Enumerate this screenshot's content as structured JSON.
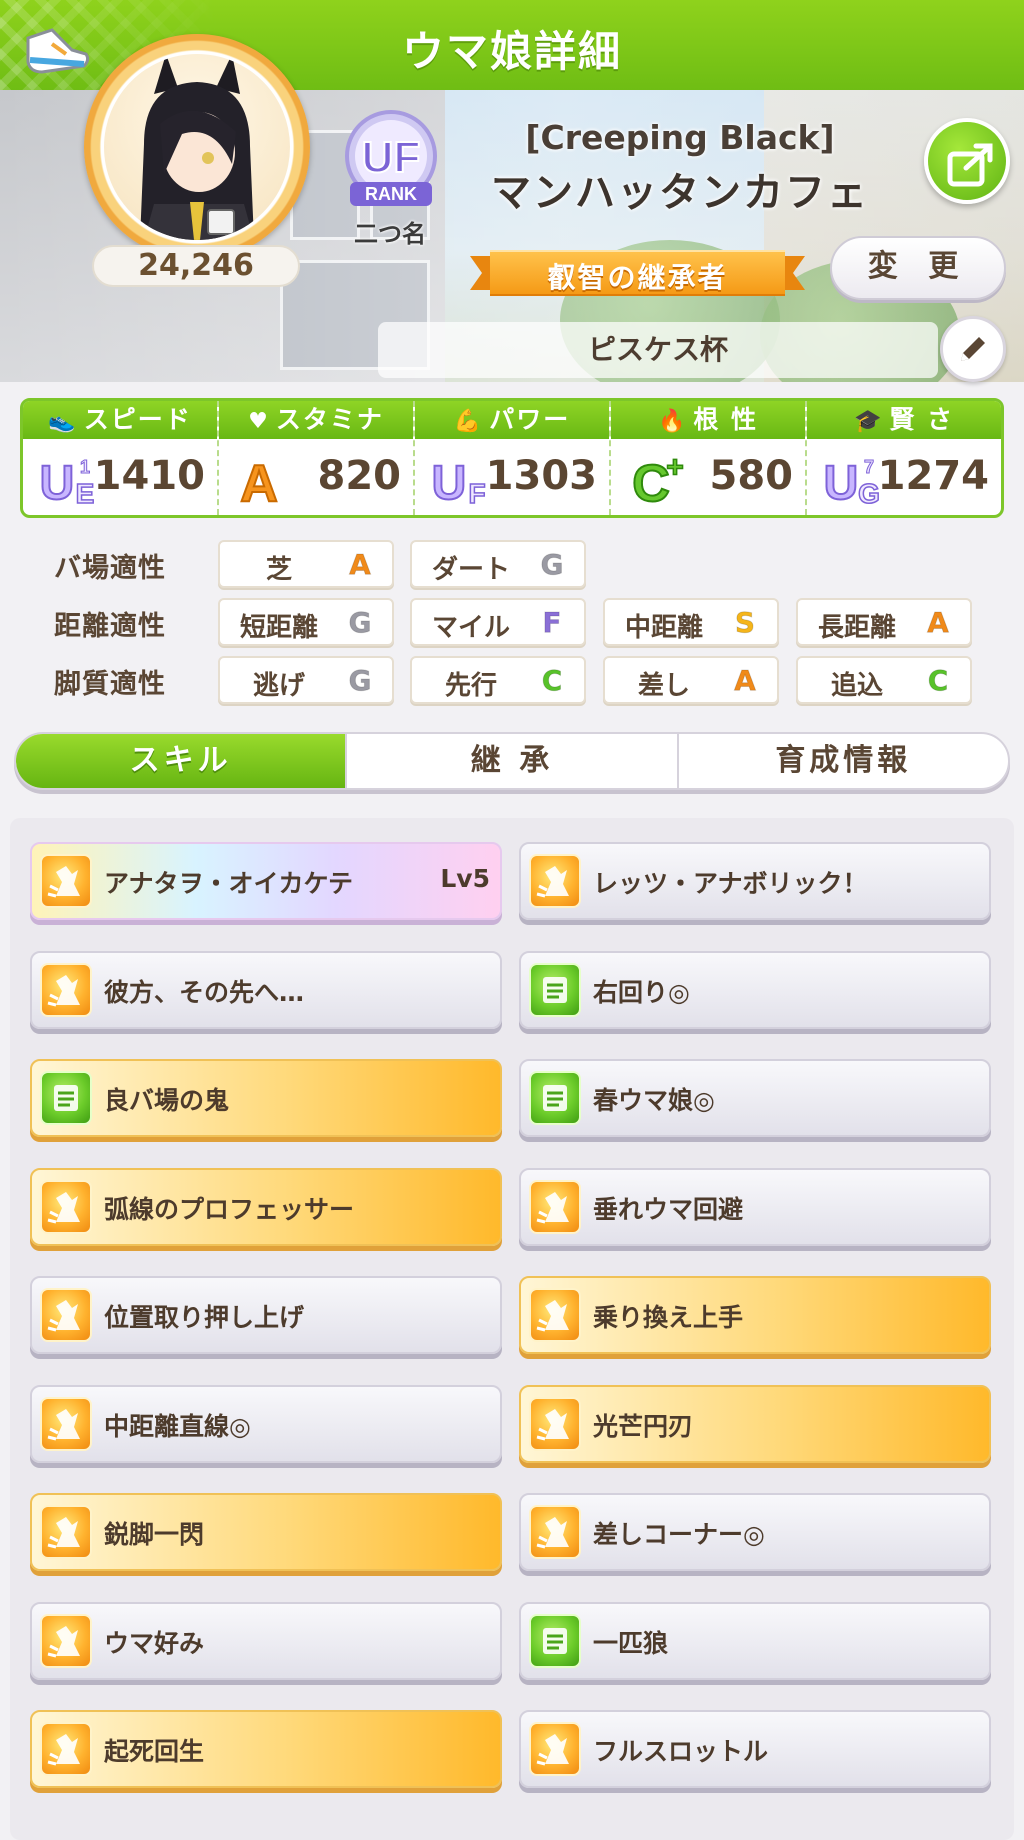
{
  "header": {
    "title": "ウマ娘詳細"
  },
  "profile": {
    "score": "24,246",
    "rank_label": "RANK",
    "rank_grade": "UF",
    "nickname": "二つ名",
    "costume": "[Creeping Black]",
    "name": "マンハッタンカフェ",
    "title": "叡智の継承者",
    "change_label": "変 更",
    "race": "ピスケス杯"
  },
  "stats": [
    {
      "label": "スピード",
      "icon": "shoe-icon",
      "grade": "UE",
      "grade_sub": "1",
      "value": "1410"
    },
    {
      "label": "スタミナ",
      "icon": "heart-icon",
      "grade": "A",
      "grade_sub": "",
      "value": "820"
    },
    {
      "label": "パワー",
      "icon": "muscle-icon",
      "grade": "UF",
      "grade_sub": "",
      "value": "1303"
    },
    {
      "label": "根 性",
      "icon": "flame-icon",
      "grade": "C+",
      "grade_sub": "",
      "value": "580"
    },
    {
      "label": "賢 さ",
      "icon": "grad-cap-icon",
      "grade": "UG",
      "grade_sub": "7",
      "value": "1274"
    }
  ],
  "aptitude": {
    "track": {
      "label": "バ場適性",
      "items": [
        {
          "name": "芝",
          "grade": "A"
        },
        {
          "name": "ダート",
          "grade": "G"
        }
      ]
    },
    "distance": {
      "label": "距離適性",
      "items": [
        {
          "name": "短距離",
          "grade": "G"
        },
        {
          "name": "マイル",
          "grade": "F"
        },
        {
          "name": "中距離",
          "grade": "S"
        },
        {
          "name": "長距離",
          "grade": "A"
        }
      ]
    },
    "style": {
      "label": "脚質適性",
      "items": [
        {
          "name": "逃げ",
          "grade": "G"
        },
        {
          "name": "先行",
          "grade": "C"
        },
        {
          "name": "差し",
          "grade": "A"
        },
        {
          "name": "追込",
          "grade": "C"
        }
      ]
    }
  },
  "grade_colors": {
    "S": "#f5b51a",
    "A": "#f08a1a",
    "C": "#58c22a",
    "F": "#8a6fd6",
    "G": "#9a9aa3"
  },
  "tabs": [
    "スキル",
    "継 承",
    "育成情報"
  ],
  "skills": [
    {
      "name": "アナタヲ・オイカケテ",
      "level": "Lv5",
      "style": "rainbow",
      "icon": "orange"
    },
    {
      "name": "レッツ・アナボリック！",
      "level": "",
      "style": "silver",
      "icon": "orange"
    },
    {
      "name": "彼方、その先へ…",
      "level": "",
      "style": "silver",
      "icon": "orange"
    },
    {
      "name": "右回り◎",
      "level": "",
      "style": "silver",
      "icon": "green"
    },
    {
      "name": "良バ場の鬼",
      "level": "",
      "style": "gold",
      "icon": "green"
    },
    {
      "name": "春ウマ娘◎",
      "level": "",
      "style": "silver",
      "icon": "green"
    },
    {
      "name": "弧線のプロフェッサー",
      "level": "",
      "style": "gold",
      "icon": "orange"
    },
    {
      "name": "垂れウマ回避",
      "level": "",
      "style": "silver",
      "icon": "orange"
    },
    {
      "name": "位置取り押し上げ",
      "level": "",
      "style": "silver",
      "icon": "orange"
    },
    {
      "name": "乗り換え上手",
      "level": "",
      "style": "gold",
      "icon": "orange"
    },
    {
      "name": "中距離直線◎",
      "level": "",
      "style": "silver",
      "icon": "orange"
    },
    {
      "name": "光芒円刃",
      "level": "",
      "style": "gold",
      "icon": "orange"
    },
    {
      "name": "鋭脚一閃",
      "level": "",
      "style": "gold",
      "icon": "orange"
    },
    {
      "name": "差しコーナー◎",
      "level": "",
      "style": "silver",
      "icon": "orange"
    },
    {
      "name": "ウマ好み",
      "level": "",
      "style": "silver",
      "icon": "orange"
    },
    {
      "name": "一匹狼",
      "level": "",
      "style": "silver",
      "icon": "green"
    },
    {
      "name": "起死回生",
      "level": "",
      "style": "gold",
      "icon": "orange"
    },
    {
      "name": "フルスロットル",
      "level": "",
      "style": "silver",
      "icon": "orange"
    }
  ]
}
